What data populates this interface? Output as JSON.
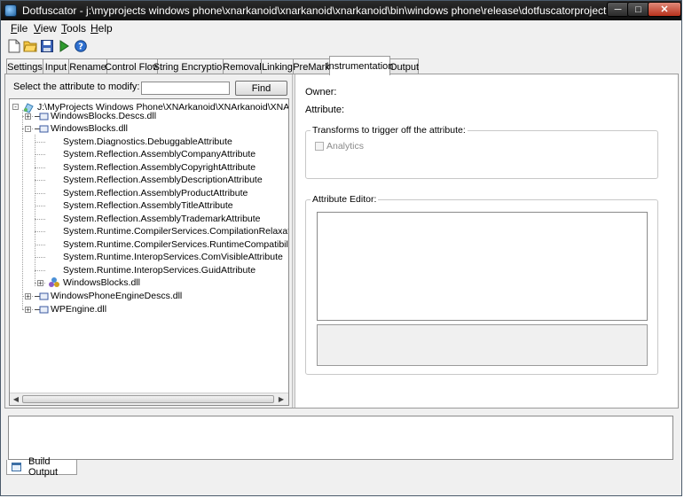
{
  "window": {
    "title": "Dotfuscator - j:\\myprojects windows phone\\xnarkanoid\\xnarkanoid\\xnarkanoid\\bin\\windows phone\\release\\dotfuscatorproject.xml",
    "min_glyph": "─",
    "max_glyph": "□",
    "close_glyph": "✕"
  },
  "menu": [
    {
      "key": "F",
      "rest": "ile"
    },
    {
      "key": "V",
      "rest": "iew"
    },
    {
      "key": "T",
      "rest": "ools"
    },
    {
      "key": "H",
      "rest": "elp"
    }
  ],
  "toolbar": {
    "icons": [
      "new-file-icon",
      "open-folder-icon",
      "save-icon",
      "run-icon",
      "help-icon"
    ]
  },
  "tabs": [
    {
      "label": "Settings"
    },
    {
      "label": "Input"
    },
    {
      "label": "Rename"
    },
    {
      "label": "Control Flow"
    },
    {
      "label": "String Encryption"
    },
    {
      "label": "Removal"
    },
    {
      "label": "Linking"
    },
    {
      "label": "PreMark"
    },
    {
      "label": "Instrumentation",
      "active": true
    },
    {
      "label": "Output"
    }
  ],
  "left": {
    "select_label": "Select the attribute to modify:",
    "search_value": "",
    "find_label": "Find"
  },
  "tree": {
    "root": "J:\\MyProjects Windows Phone\\XNArkanoid\\XNArkanoid\\XNArkanoid\\bin\\",
    "nodes": [
      {
        "label": "WindowsBlocks.Descs.dll",
        "expander": "+"
      },
      {
        "label": "WindowsBlocks.dll",
        "expander": "-"
      },
      {
        "label": "System.Diagnostics.DebuggableAttribute"
      },
      {
        "label": "System.Reflection.AssemblyCompanyAttribute"
      },
      {
        "label": "System.Reflection.AssemblyCopyrightAttribute"
      },
      {
        "label": "System.Reflection.AssemblyDescriptionAttribute"
      },
      {
        "label": "System.Reflection.AssemblyProductAttribute"
      },
      {
        "label": "System.Reflection.AssemblyTitleAttribute"
      },
      {
        "label": "System.Reflection.AssemblyTrademarkAttribute"
      },
      {
        "label": "System.Runtime.CompilerServices.CompilationRelaxationsAttribute"
      },
      {
        "label": "System.Runtime.CompilerServices.RuntimeCompatibilityAttribute"
      },
      {
        "label": "System.Runtime.InteropServices.ComVisibleAttribute"
      },
      {
        "label": "System.Runtime.InteropServices.GuidAttribute"
      },
      {
        "label": "WindowsBlocks.dll",
        "expander": "+"
      },
      {
        "label": "WindowsPhoneEngineDescs.dll",
        "expander": "+"
      },
      {
        "label": "WPEngine.dll",
        "expander": "+"
      }
    ]
  },
  "right": {
    "owner_label": "Owner:",
    "attribute_label": "Attribute:",
    "transforms_title": "Transforms to trigger off the attribute:",
    "analytics_label": "Analytics",
    "analytics_checked": false,
    "editor_title": "Attribute Editor:"
  },
  "bottom": {
    "build_output_label": "Build Output"
  },
  "colors": {
    "titlebar": "#1a1a1a",
    "close_button": "#c8432a",
    "background": "#f0f0f0"
  }
}
